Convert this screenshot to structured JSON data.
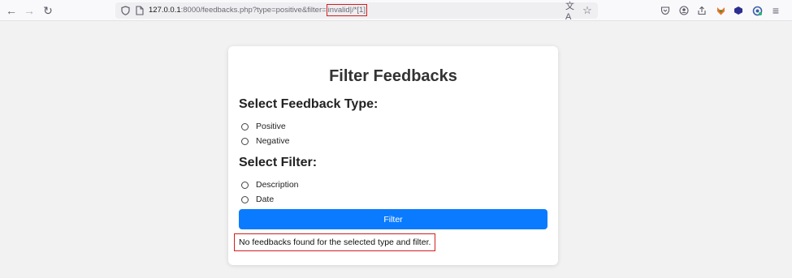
{
  "browser": {
    "url_host": "127.0.0.1",
    "url_rest": ":8000/feedbacks.php?type=positive&filter=",
    "url_highlight": "invalid|/*[1]",
    "back_glyph": "←",
    "forward_glyph": "→",
    "reload_glyph": "↻",
    "translate_glyph": "文A",
    "bookmark_glyph": "☆",
    "menu_glyph": "≡",
    "extension_icons": [
      "pocket-icon",
      "account-icon",
      "share-icon",
      "fox-extension-icon",
      "cube-extension-icon",
      "gear-extension-icon"
    ]
  },
  "form": {
    "title": "Filter Feedbacks",
    "type_heading": "Select Feedback Type:",
    "type_options": [
      "Positive",
      "Negative"
    ],
    "filter_heading": "Select Filter:",
    "filter_options": [
      "Description",
      "Date"
    ],
    "button_label": "Filter",
    "message": "No feedbacks found for the selected type and filter."
  },
  "colors": {
    "button": "#0a7bff",
    "highlight_border": "#d11f1f",
    "page_bg": "#f2f2f2"
  }
}
